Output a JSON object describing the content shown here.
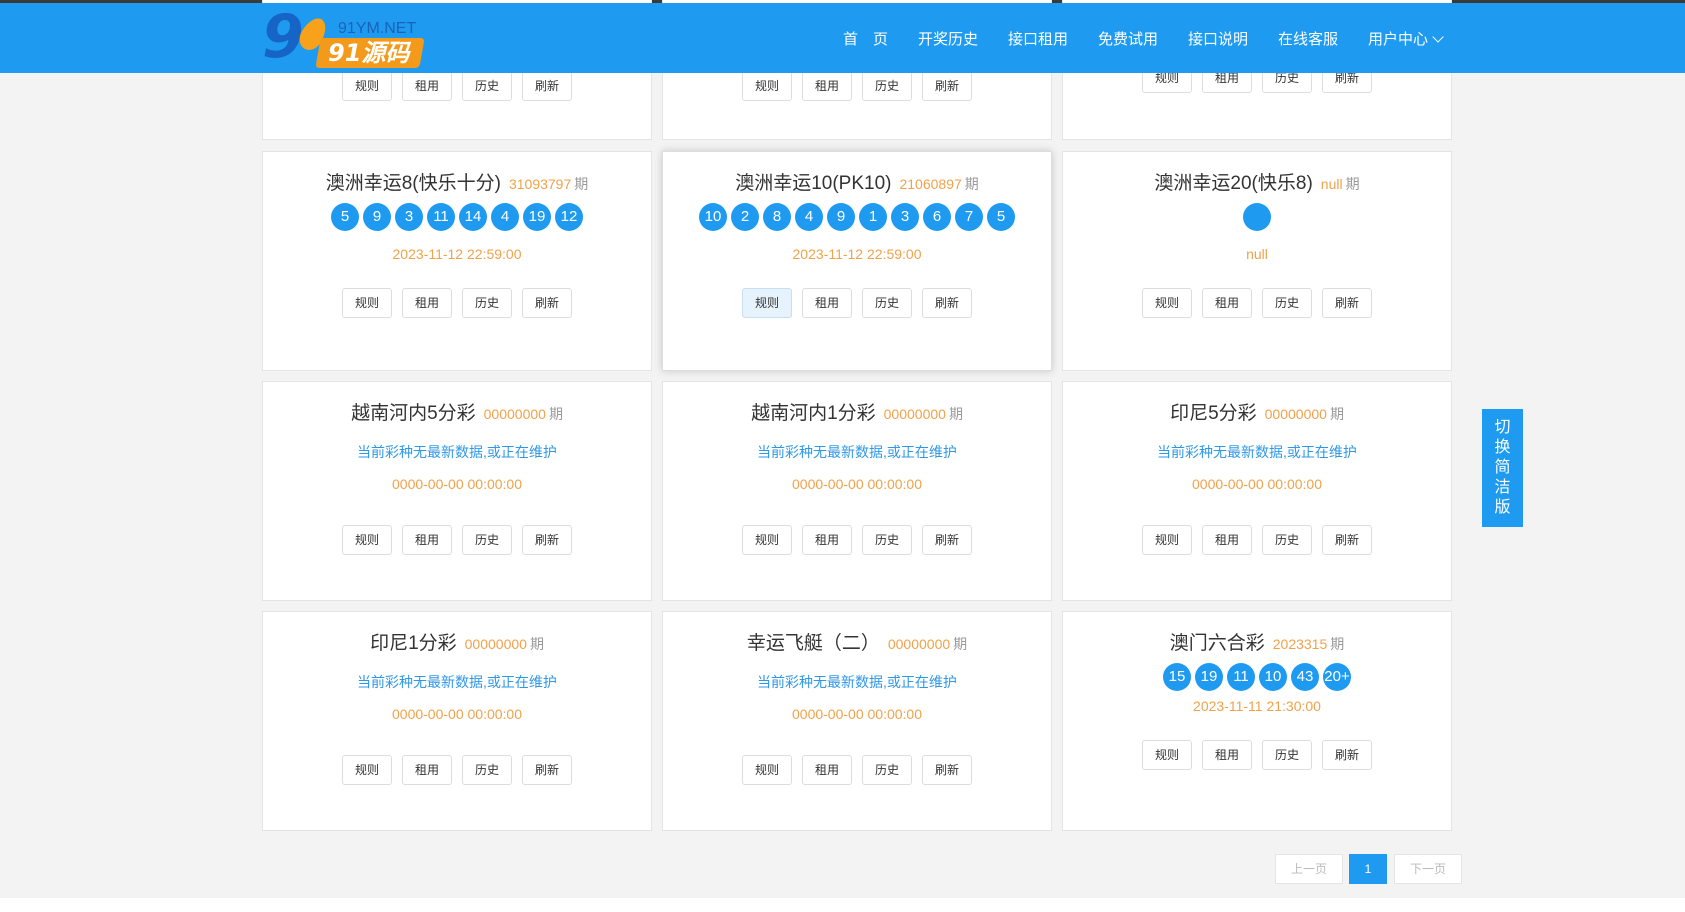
{
  "logo": {
    "net": "91YM.NET",
    "brand": "91源码",
    "nine": "9"
  },
  "nav": [
    {
      "label": "首　页"
    },
    {
      "label": "开奖历史"
    },
    {
      "label": "接口租用"
    },
    {
      "label": "免费试用"
    },
    {
      "label": "接口说明"
    },
    {
      "label": "在线客服"
    },
    {
      "label": "用户中心"
    }
  ],
  "buttons": {
    "rule": "规则",
    "rent": "租用",
    "history": "历史",
    "refresh": "刷新"
  },
  "unit": "期",
  "cards": [
    {
      "name": "澳洲幸运8(快乐十分)",
      "issue": "31093797",
      "balls": [
        "5",
        "9",
        "3",
        "11",
        "14",
        "4",
        "19",
        "12"
      ],
      "time": "2023-11-12 22:59:00"
    },
    {
      "name": "澳洲幸运10(PK10)",
      "issue": "21060897",
      "balls": [
        "10",
        "2",
        "8",
        "4",
        "9",
        "1",
        "3",
        "6",
        "7",
        "5"
      ],
      "time": "2023-11-12 22:59:00"
    },
    {
      "name": "澳洲幸运20(快乐8)",
      "issue": "null",
      "balls": [
        ""
      ],
      "time": "null"
    },
    {
      "name": "越南河内5分彩",
      "issue": "00000000",
      "notice": "当前彩种无最新数据,或正在维护",
      "time": "0000-00-00 00:00:00"
    },
    {
      "name": "越南河内1分彩",
      "issue": "00000000",
      "notice": "当前彩种无最新数据,或正在维护",
      "time": "0000-00-00 00:00:00"
    },
    {
      "name": "印尼5分彩",
      "issue": "00000000",
      "notice": "当前彩种无最新数据,或正在维护",
      "time": "0000-00-00 00:00:00"
    },
    {
      "name": "印尼1分彩",
      "issue": "00000000",
      "notice": "当前彩种无最新数据,或正在维护",
      "time": "0000-00-00 00:00:00"
    },
    {
      "name": "幸运飞艇（二）",
      "issue": "00000000",
      "notice": "当前彩种无最新数据,或正在维护",
      "time": "0000-00-00 00:00:00"
    },
    {
      "name": "澳门六合彩",
      "issue": "2023315",
      "balls": [
        "15",
        "19",
        "11",
        "10",
        "43",
        "20+"
      ],
      "time": "2023-11-11 21:30:00"
    }
  ],
  "side_switch": [
    "切",
    "换",
    "简",
    "洁",
    "版"
  ],
  "pagination": {
    "prev": "上一页",
    "current": "1",
    "next": "下一页"
  },
  "colors": {
    "primary": "#1e9bf1",
    "accent": "#f0a24a",
    "notice": "#2e98e8"
  }
}
